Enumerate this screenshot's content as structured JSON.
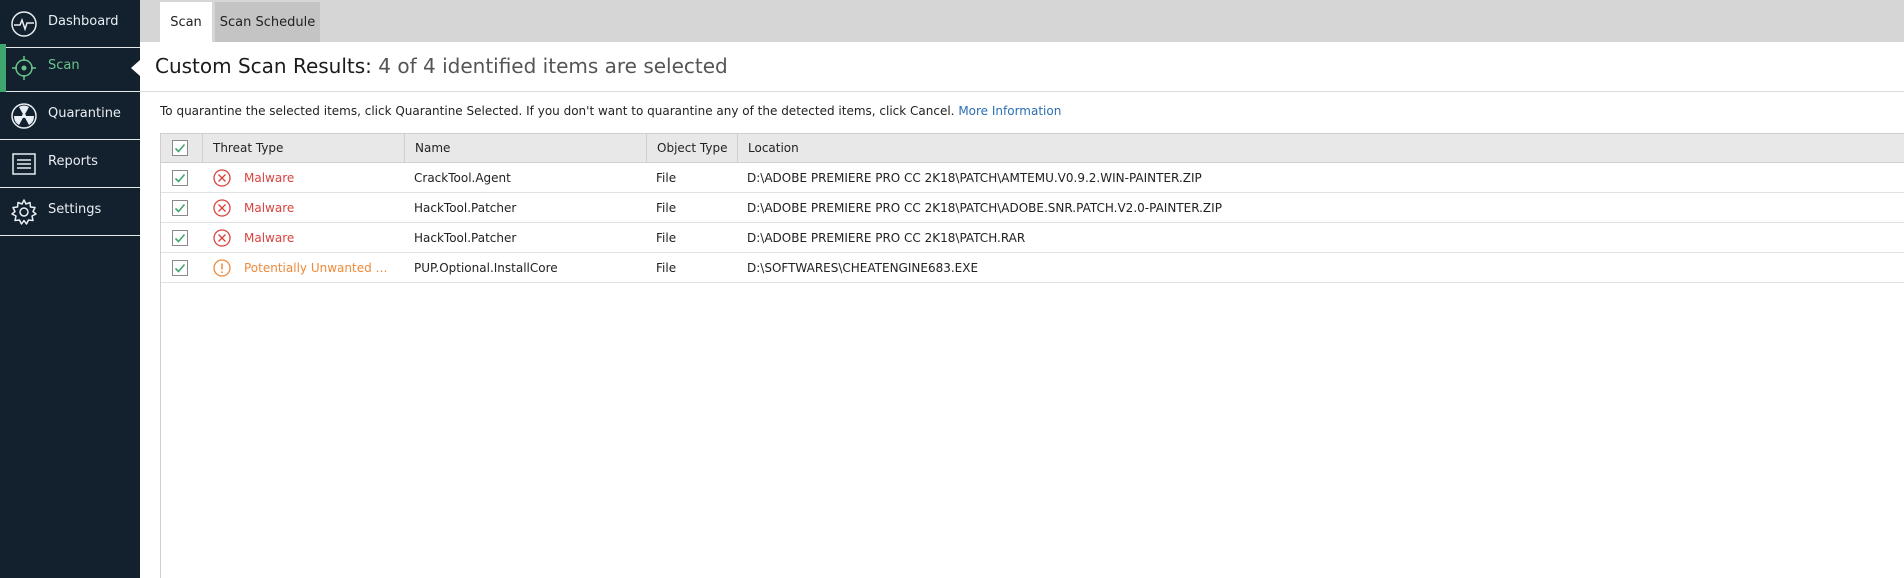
{
  "sidebar": {
    "items": [
      {
        "label": "Dashboard",
        "icon": "pulse-icon"
      },
      {
        "label": "Scan",
        "icon": "crosshair-icon"
      },
      {
        "label": "Quarantine",
        "icon": "radiation-icon"
      },
      {
        "label": "Reports",
        "icon": "list-icon"
      },
      {
        "label": "Settings",
        "icon": "gear-icon"
      }
    ],
    "active_color": "#6ac58d"
  },
  "tabs": [
    {
      "label": "Scan"
    },
    {
      "label": "Scan Schedule"
    }
  ],
  "heading": {
    "title": "Custom Scan Results:",
    "subtitle": "4 of 4 identified items are selected"
  },
  "info": {
    "text": "To quarantine the selected items, click Quarantine Selected. If you don't want to quarantine any of the detected items, click Cancel.",
    "link": "More Information"
  },
  "table": {
    "columns": [
      "Threat Type",
      "Name",
      "Object Type",
      "Location"
    ],
    "rows": [
      {
        "threat": "Malware",
        "severity": "malware",
        "name": "CrackTool.Agent",
        "type": "File",
        "location": "D:\\ADOBE PREMIERE PRO CC 2K18\\PATCH\\AMTEMU.V0.9.2.WIN-PAINTER.ZIP",
        "checked": true
      },
      {
        "threat": "Malware",
        "severity": "malware",
        "name": "HackTool.Patcher",
        "type": "File",
        "location": "D:\\ADOBE PREMIERE PRO CC 2K18\\PATCH\\ADOBE.SNR.PATCH.V2.0-PAINTER.ZIP",
        "checked": true
      },
      {
        "threat": "Malware",
        "severity": "malware",
        "name": "HackTool.Patcher",
        "type": "File",
        "location": "D:\\ADOBE PREMIERE PRO CC 2K18\\PATCH.RAR",
        "checked": true
      },
      {
        "threat": "Potentially Unwanted Pr...",
        "severity": "pup",
        "name": "PUP.Optional.InstallCore",
        "type": "File",
        "location": "D:\\SOFTWARES\\CHEATENGINE683.EXE",
        "checked": true
      }
    ]
  },
  "colors": {
    "malware": "#d9443f",
    "pup": "#ee8a3a",
    "check": "#3fa66f",
    "link": "#2a6fb3"
  }
}
